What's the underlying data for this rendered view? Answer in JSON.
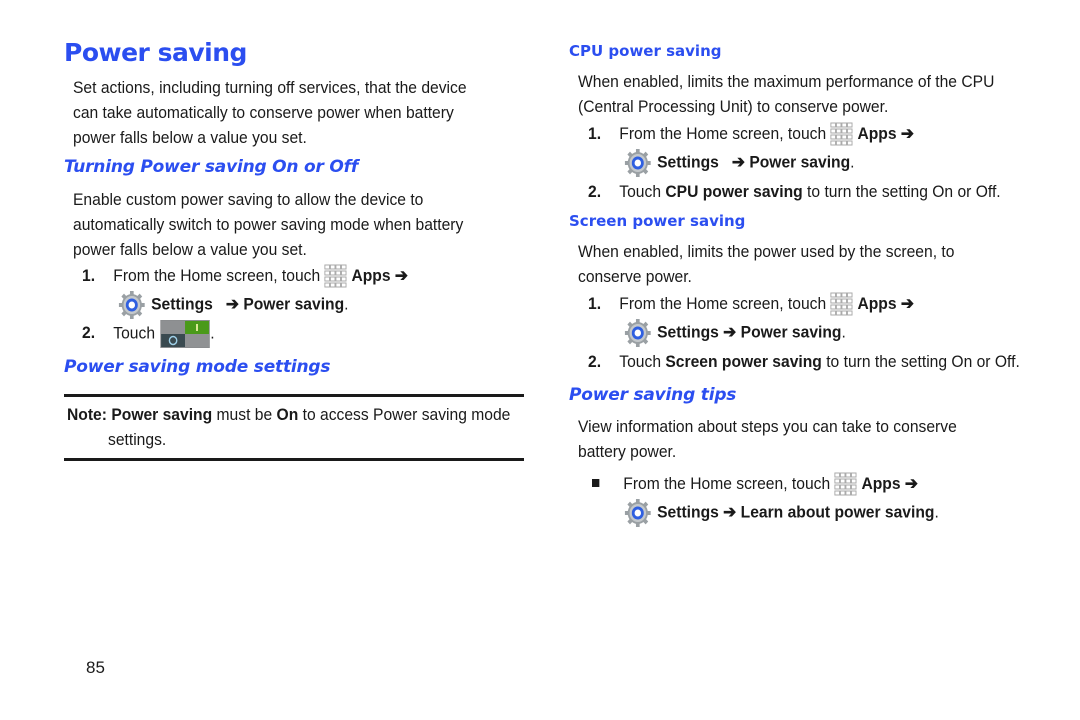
{
  "page": {
    "title": "Power saving",
    "intro": [
      "Set actions, including turning off services, that the device",
      "can take automatically to conserve power when battery",
      "power falls below a value you set."
    ],
    "page_number": "85"
  },
  "turning": {
    "heading": "Turning Power saving On or Off",
    "para": [
      "Enable custom power saving to allow the device to",
      "automatically switch to power saving mode when battery",
      "power falls below a value you set."
    ],
    "step1_num": "1.",
    "step1_text": "From the Home screen, touch",
    "apps": "Apps",
    "arrow": "➔",
    "settings": "Settings",
    "power_saving": "Power saving",
    "period": ".",
    "step2_num": "2.",
    "step2_text": "Touch"
  },
  "mode_settings": {
    "heading": "Power saving mode settings",
    "note_label": "Note:",
    "note_bold1": "Power saving",
    "note_text1": "must be",
    "note_bold2": "On",
    "note_text2": "to access Power saving mode",
    "note_line2": "settings."
  },
  "cpu": {
    "heading": "CPU power saving",
    "para": [
      "When enabled, limits the maximum performance of the CPU",
      "(Central Processing Unit) to conserve power."
    ],
    "step1_num": "1.",
    "step1_text": "From the Home screen, touch",
    "apps": "Apps",
    "arrow": "➔",
    "settings": "Settings",
    "power_saving": "Power saving",
    "period": ".",
    "step2_num": "2.",
    "step2_pre": "Touch",
    "step2_bold": "CPU power saving",
    "step2_post": "to turn the setting On or Off."
  },
  "screen": {
    "heading": "Screen power saving",
    "para": [
      "When enabled, limits the power used by the screen, to",
      "conserve power."
    ],
    "step1_num": "1.",
    "step1_text": "From the Home screen, touch",
    "apps": "Apps",
    "arrow": "➔",
    "settings": "Settings",
    "power_saving": "Power saving",
    "period": ".",
    "step2_num": "2.",
    "step2_pre": "Touch",
    "step2_bold": "Screen power saving",
    "step2_post": "to turn the setting On or Off."
  },
  "tips": {
    "heading": "Power saving tips",
    "para": [
      "View information about steps you can take to conserve",
      "battery power."
    ],
    "step_text": "From the Home screen, touch",
    "apps": "Apps",
    "arrow": "➔",
    "settings": "Settings",
    "learn": "Learn about power saving",
    "period": "."
  },
  "colors": {
    "heading_blue": "#2b4ef0",
    "toggle_green": "#4a9a1a",
    "toggle_dark": "#3a4a50"
  }
}
